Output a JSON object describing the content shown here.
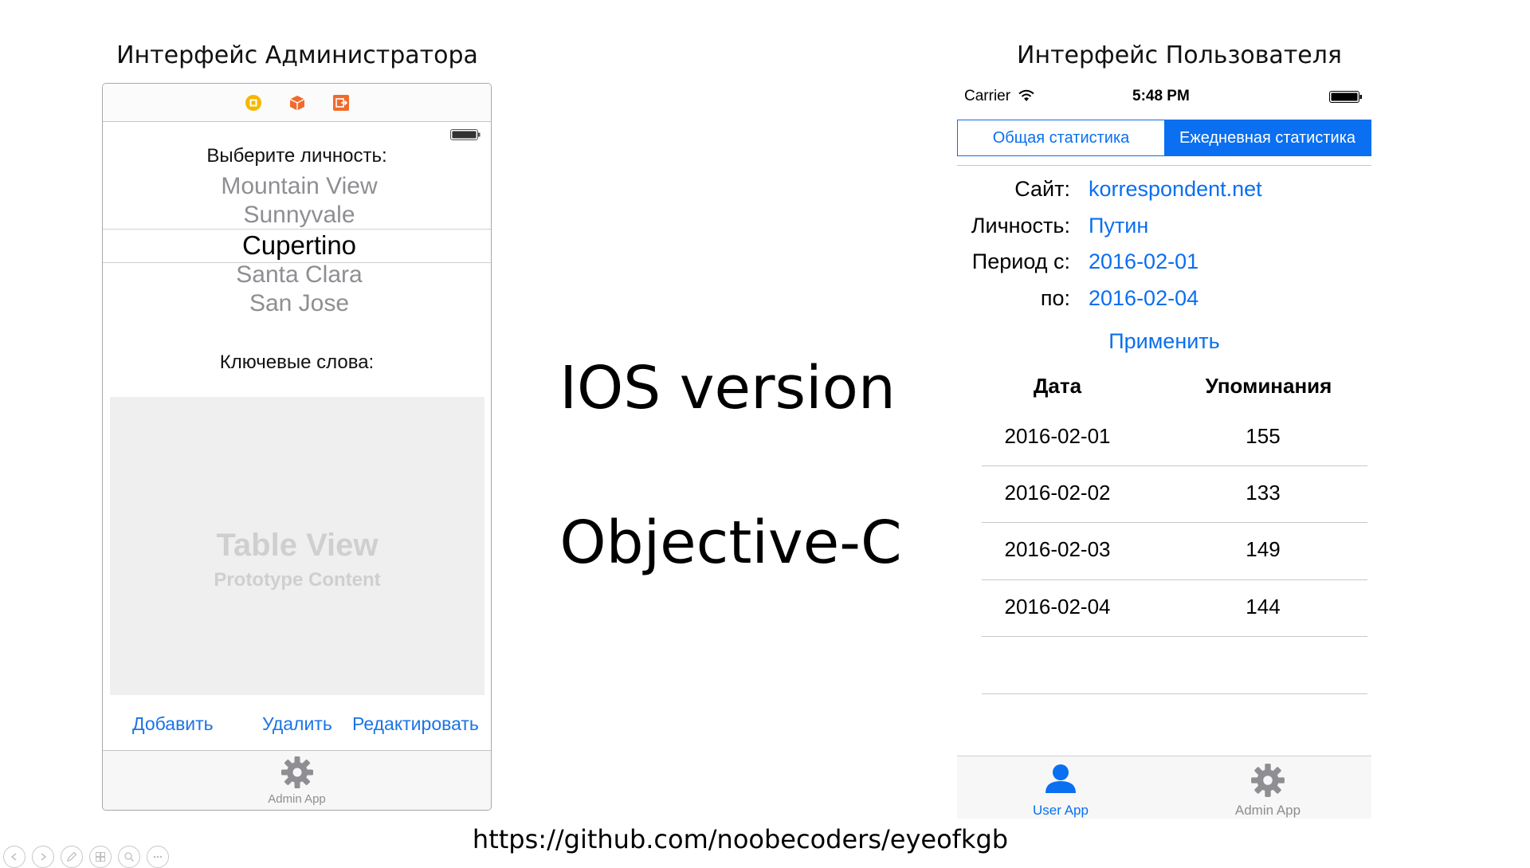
{
  "headings": {
    "admin": "Интерфейс Администратора",
    "user": "Интерфейс Пользователя"
  },
  "center": {
    "line1": "IOS version",
    "line2": "Objective-C"
  },
  "footer_url": "https://github.com/noobecoders/eyeofkgb",
  "admin": {
    "picker_label": "Выберите личность:",
    "picker_items": [
      "Mountain View",
      "Sunnyvale",
      "Cupertino",
      "Santa Clara",
      "San Jose"
    ],
    "keywords_label": "Ключевые слова:",
    "table_placeholder_title": "Table View",
    "table_placeholder_subtitle": "Prototype Content",
    "buttons": {
      "add": "Добавить",
      "delete": "Удалить",
      "edit": "Редактировать"
    },
    "tab_label": "Admin App",
    "toolbar_icons": [
      "view-controller-icon",
      "cube-icon",
      "exit-icon"
    ]
  },
  "user": {
    "status": {
      "carrier": "Carrier",
      "time": "5:48 PM"
    },
    "segments": {
      "overall": "Общая статистика",
      "daily": "Ежедневная статистика",
      "selected": "daily"
    },
    "fields": {
      "site_label": "Сайт:",
      "site_value": "korrespondent.net",
      "person_label": "Личность:",
      "person_value": "Путин",
      "period_from_label": "Период с:",
      "period_from_value": "2016-02-01",
      "period_to_label": "по:",
      "period_to_value": "2016-02-04"
    },
    "apply_button": "Применить",
    "table": {
      "headers": [
        "Дата",
        "Упоминания"
      ],
      "rows": [
        [
          "2016-02-01",
          "155"
        ],
        [
          "2016-02-02",
          "133"
        ],
        [
          "2016-02-03",
          "149"
        ],
        [
          "2016-02-04",
          "144"
        ]
      ]
    },
    "tabs": {
      "user": "User App",
      "admin": "Admin App",
      "active": "user"
    }
  },
  "colors": {
    "ios_blue": "#0a6ff0",
    "gray_text": "#8e8e93",
    "toolbar_yellow": "#f5b700",
    "toolbar_orange": "#f26a2b"
  }
}
